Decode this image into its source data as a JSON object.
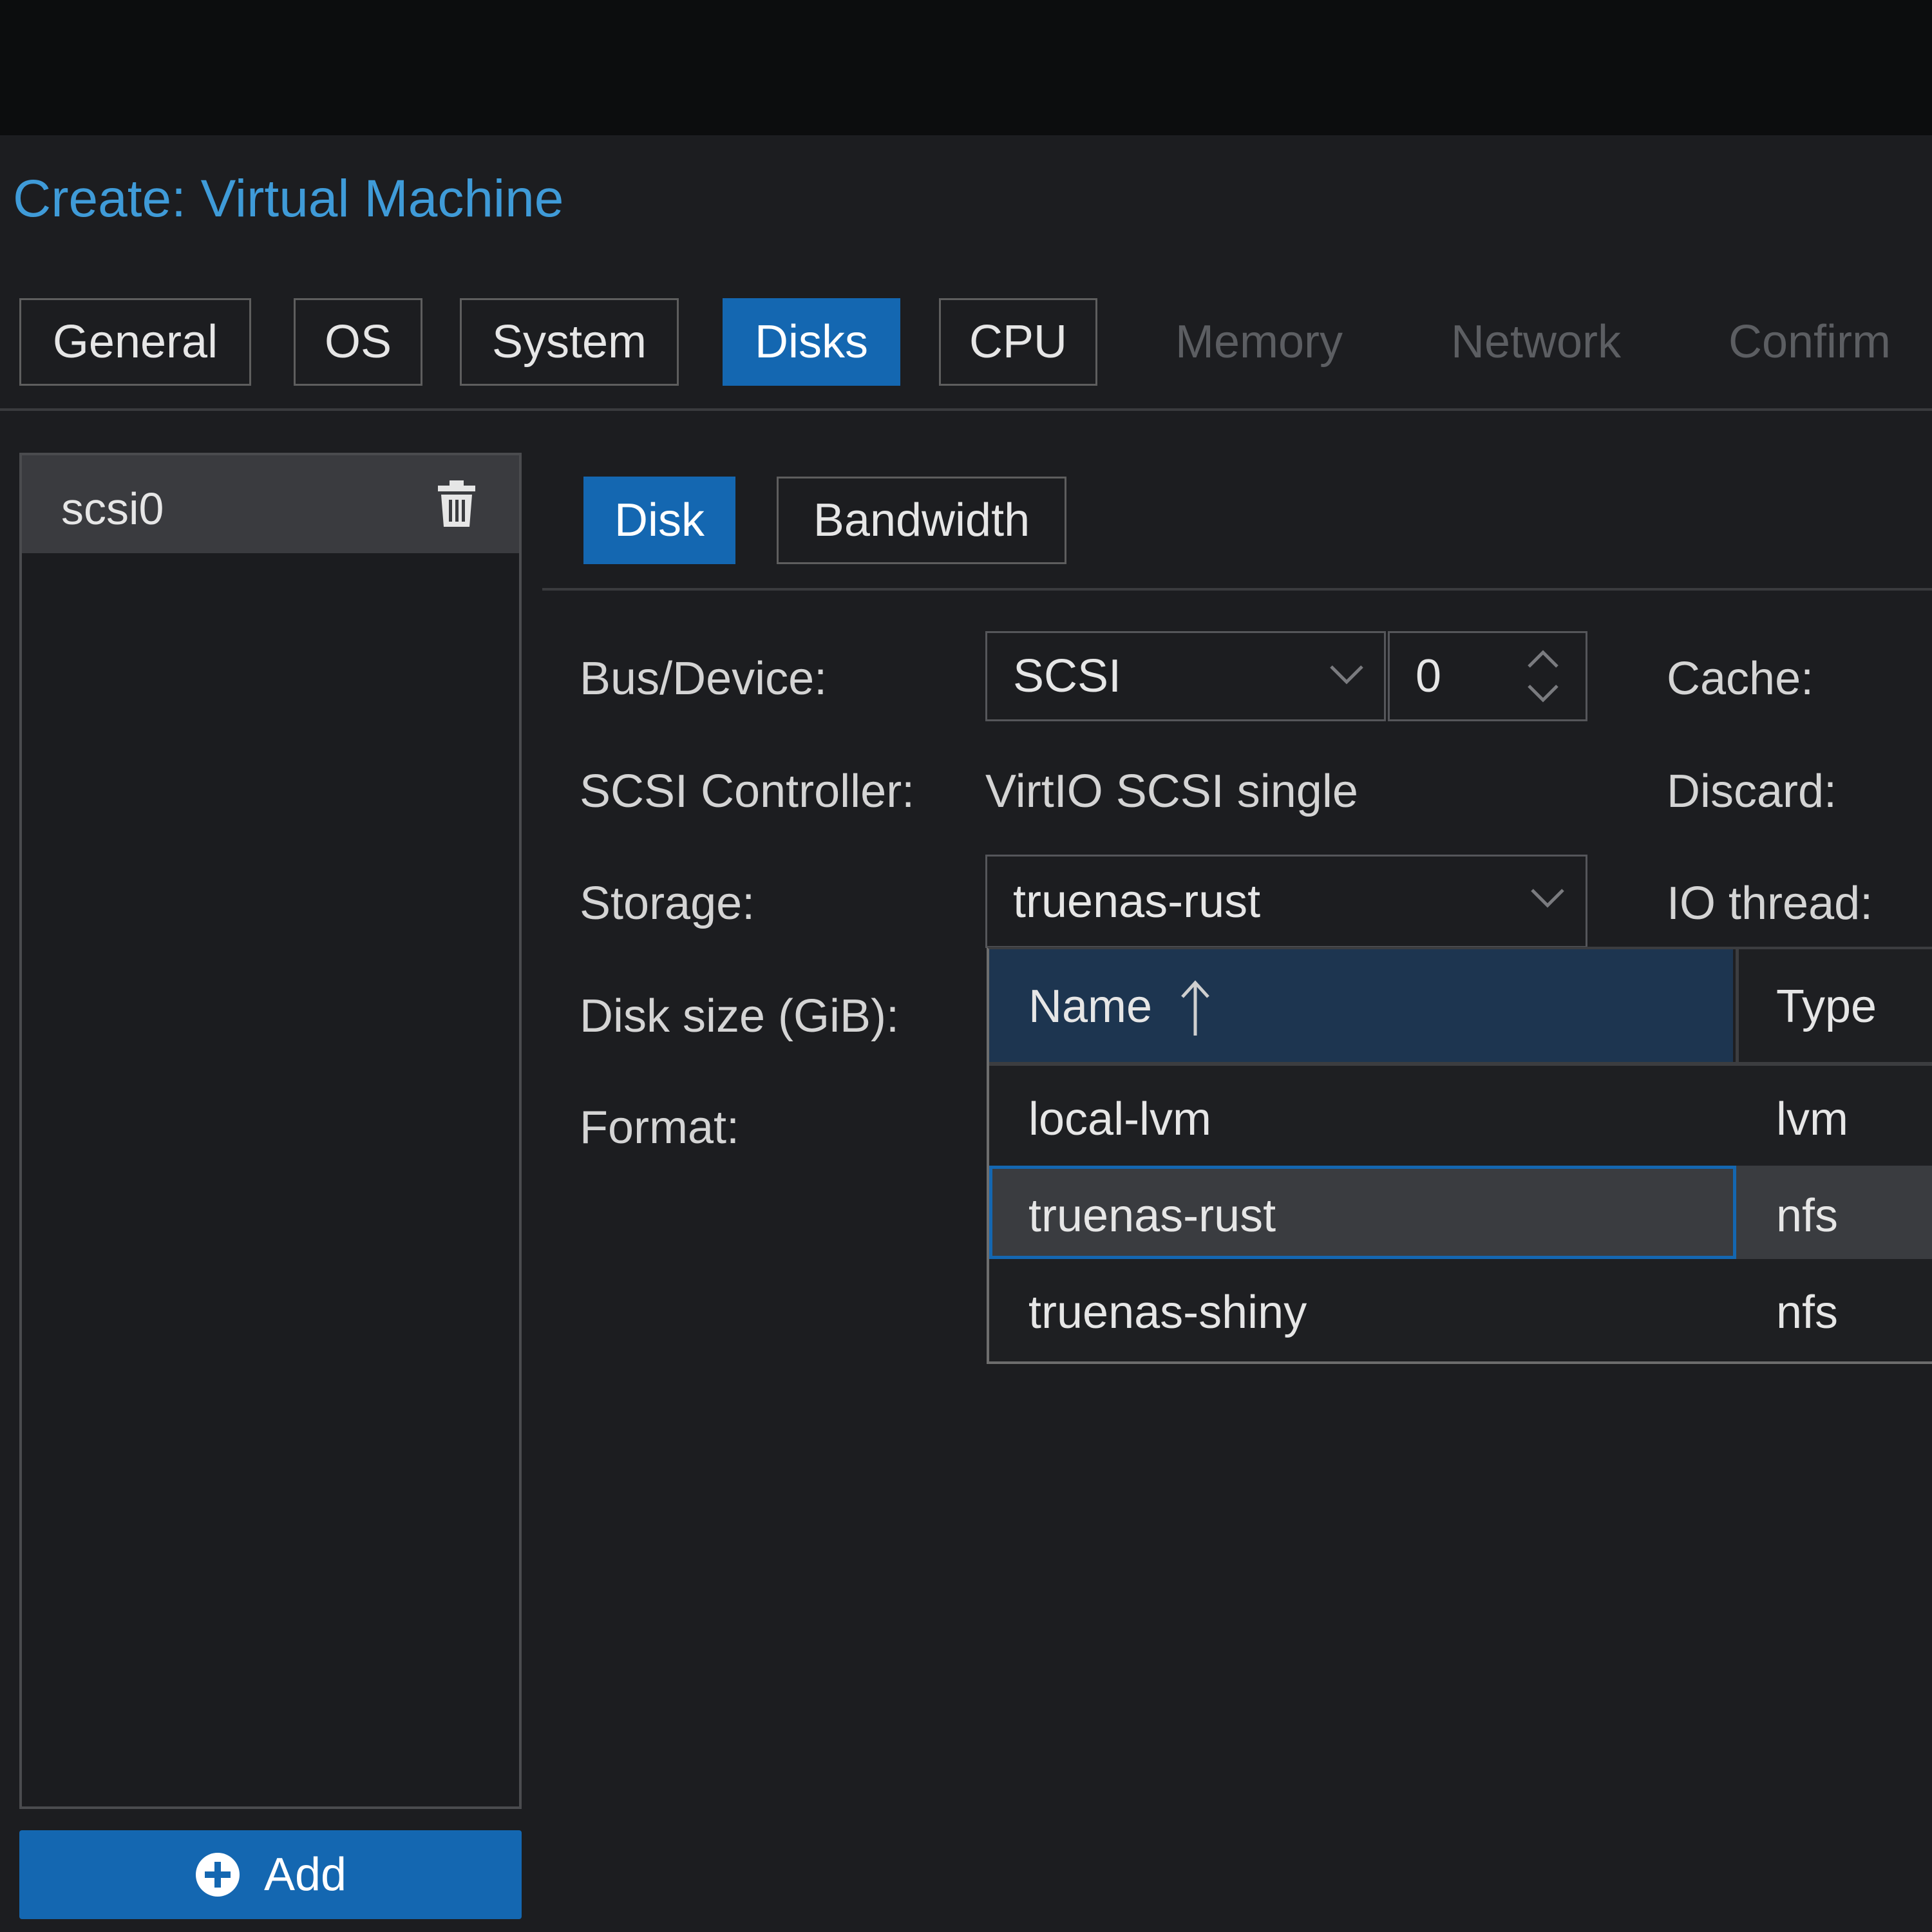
{
  "window": {
    "title": "Create: Virtual Machine"
  },
  "wizard_tabs": [
    {
      "label": "General",
      "state": "enabled"
    },
    {
      "label": "OS",
      "state": "enabled"
    },
    {
      "label": "System",
      "state": "enabled"
    },
    {
      "label": "Disks",
      "state": "active"
    },
    {
      "label": "CPU",
      "state": "enabled"
    },
    {
      "label": "Memory",
      "state": "disabled"
    },
    {
      "label": "Network",
      "state": "disabled"
    },
    {
      "label": "Confirm",
      "state": "disabled"
    }
  ],
  "disk_list": {
    "items": [
      {
        "label": "scsi0"
      }
    ],
    "add_label": "Add"
  },
  "subtabs": [
    {
      "label": "Disk",
      "state": "active"
    },
    {
      "label": "Bandwidth",
      "state": "enabled"
    }
  ],
  "form": {
    "bus_device_label": "Bus/Device:",
    "bus_value": "SCSI",
    "device_index": "0",
    "scsi_controller_label": "SCSI Controller:",
    "scsi_controller_value": "VirtIO SCSI single",
    "storage_label": "Storage:",
    "storage_value": "truenas-rust",
    "disk_size_label": "Disk size (GiB):",
    "format_label": "Format:",
    "cache_label": "Cache:",
    "discard_label": "Discard:",
    "io_thread_label": "IO thread:"
  },
  "storage_dropdown": {
    "columns": [
      {
        "label": "Name",
        "sort": "ascending"
      },
      {
        "label": "Type"
      }
    ],
    "rows": [
      {
        "name": "local-lvm",
        "type": "lvm",
        "selected": false
      },
      {
        "name": "truenas-rust",
        "type": "nfs",
        "selected": true
      },
      {
        "name": "truenas-shiny",
        "type": "nfs",
        "selected": false
      }
    ]
  },
  "colors": {
    "accent": "#1467b1",
    "title": "#3f9bd8",
    "background": "#1c1d20"
  }
}
